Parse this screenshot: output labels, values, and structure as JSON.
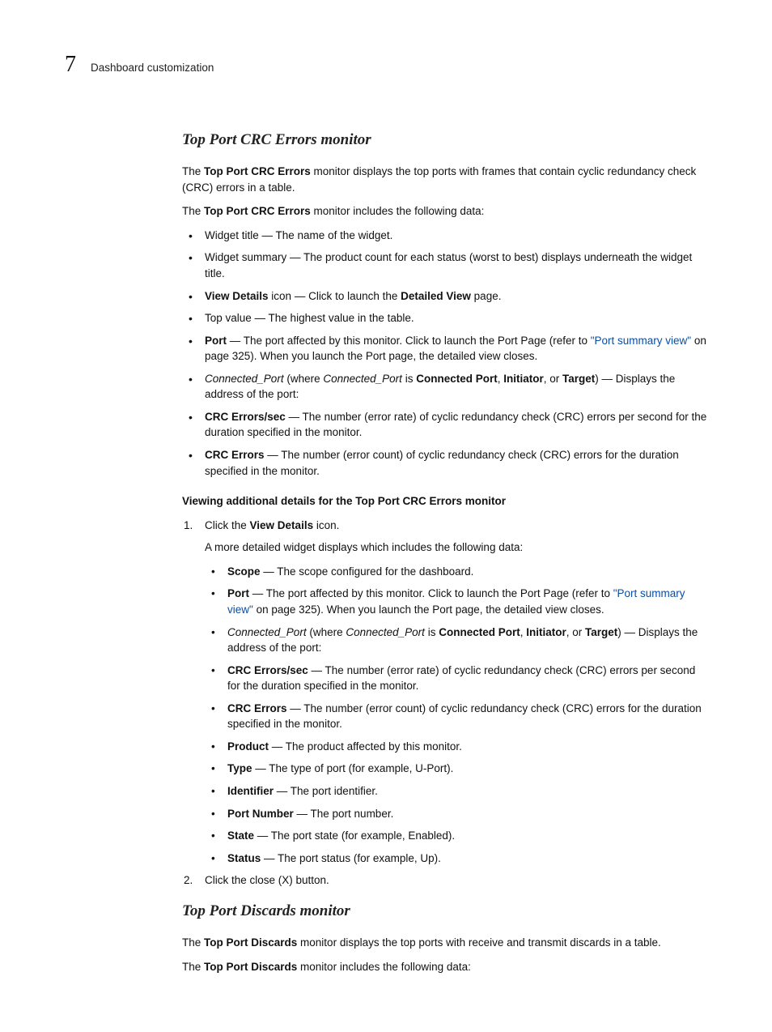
{
  "header": {
    "chapter_number": "7",
    "section_title": "Dashboard customization"
  },
  "s1": {
    "title": "Top Port CRC Errors monitor",
    "p1_a": "The ",
    "p1_b": "Top Port CRC Errors",
    "p1_c": " monitor displays the top ports with frames that contain cyclic redundancy check (CRC) errors in a table.",
    "p2_a": "The ",
    "p2_b": "Top Port CRC Errors",
    "p2_c": " monitor includes the following data:",
    "b1": "Widget title — The name of the widget.",
    "b2": "Widget summary — The product count for each status (worst to best) displays underneath the widget title.",
    "b3_a": "View Details",
    "b3_b": " icon — Click to launch the ",
    "b3_c": "Detailed View",
    "b3_d": " page.",
    "b4": "Top value — The highest value in the table.",
    "b5_a": "Port",
    "b5_b": " — The port affected by this monitor. Click to launch the Port Page (refer to ",
    "b5_link": "\"Port summary view\"",
    "b5_c": " on page 325). When you launch the Port page, the detailed view closes.",
    "b6_a": "Connected_Port",
    "b6_b": " (where ",
    "b6_c": "Connected_Port",
    "b6_d": " is ",
    "b6_e": "Connected Port",
    "b6_f": ", ",
    "b6_g": "Initiator",
    "b6_h": ", or ",
    "b6_i": "Target",
    "b6_j": ") — Displays the address of the port:",
    "b7_a": "CRC Errors/sec",
    "b7_b": " — The number (error rate) of cyclic redundancy check (CRC) errors per second for the duration specified in the monitor.",
    "b8_a": "CRC Errors",
    "b8_b": " — The number (error count) of cyclic redundancy check (CRC) errors for the duration specified in the monitor.",
    "subhead": "Viewing additional details for the Top Port CRC Errors monitor",
    "step1_a": "Click the ",
    "step1_b": "View Details",
    "step1_c": " icon.",
    "step1_p": "A more detailed widget displays which includes the following data:",
    "d1_a": "Scope",
    "d1_b": " — The scope configured for the dashboard.",
    "d2_a": "Port",
    "d2_b": " — The port affected by this monitor. Click to launch the Port Page (refer to ",
    "d2_link": "\"Port summary view\"",
    "d2_c": " on page 325). When you launch the Port page, the detailed view closes.",
    "d3_a": "Connected_Port",
    "d3_b": " (where ",
    "d3_c": "Connected_Port",
    "d3_d": " is ",
    "d3_e": "Connected Port",
    "d3_f": ", ",
    "d3_g": "Initiator",
    "d3_h": ", or ",
    "d3_i": "Target",
    "d3_j": ") — Displays the address of the port:",
    "d4_a": "CRC Errors/sec",
    "d4_b": " — The number (error rate) of cyclic redundancy check (CRC) errors per second for the duration specified in the monitor.",
    "d5_a": "CRC Errors",
    "d5_b": " — The number (error count) of cyclic redundancy check (CRC) errors for the duration specified in the monitor.",
    "d6_a": "Product",
    "d6_b": " — The product affected by this monitor.",
    "d7_a": "Type",
    "d7_b": " — The type of port (for example, U-Port).",
    "d8_a": "Identifier",
    "d8_b": " — The port identifier.",
    "d9_a": "Port Number",
    "d9_b": " — The port number.",
    "d10_a": "State",
    "d10_b": " — The port state (for example, Enabled).",
    "d11_a": "Status",
    "d11_b": " — The port status (for example, Up).",
    "step2": "Click the close (X) button."
  },
  "s2": {
    "title": "Top Port Discards monitor",
    "p1_a": "The ",
    "p1_b": "Top Port Discards",
    "p1_c": " monitor displays the top ports with receive and transmit discards in a table.",
    "p2_a": "The ",
    "p2_b": "Top Port Discards",
    "p2_c": " monitor includes the following data:"
  }
}
